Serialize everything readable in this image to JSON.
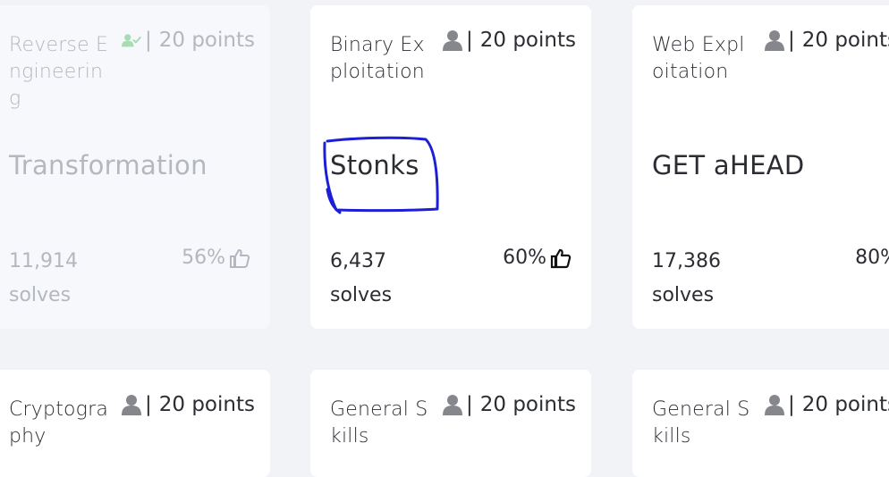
{
  "cards": [
    {
      "category": "Reverse Engineering",
      "points_label": "20 points",
      "separator": "|",
      "title": "Transformation",
      "solves_count": "11,914",
      "solves_label": "solves",
      "rating": "56%",
      "solved": true
    },
    {
      "category": "Binary Exploitation",
      "points_label": "20 points",
      "separator": "|",
      "title": "Stonks",
      "solves_count": "6,437",
      "solves_label": "solves",
      "rating": "60%",
      "solved": false
    },
    {
      "category": "Web Exploitation",
      "points_label": "20 points",
      "separator": "|",
      "title": "GET aHEAD",
      "solves_count": "17,386",
      "solves_label": "solves",
      "rating": "80%",
      "solved": false
    },
    {
      "category": "Cryptography",
      "points_label": "20 points",
      "separator": "|",
      "solved": false
    },
    {
      "category": "General Skills",
      "points_label": "20 points",
      "separator": "|",
      "solved": false
    },
    {
      "category": "General Skills",
      "points_label": "20 points",
      "separator": "|",
      "solved": false
    }
  ],
  "icons": {
    "solved_user": "user-check-icon",
    "user": "user-icon",
    "like": "thumbs-up-icon"
  },
  "colors": {
    "solved_icon": "#a8dcb4",
    "annotation": "#1d1fd6",
    "page_bg": "#f2f3f7"
  }
}
